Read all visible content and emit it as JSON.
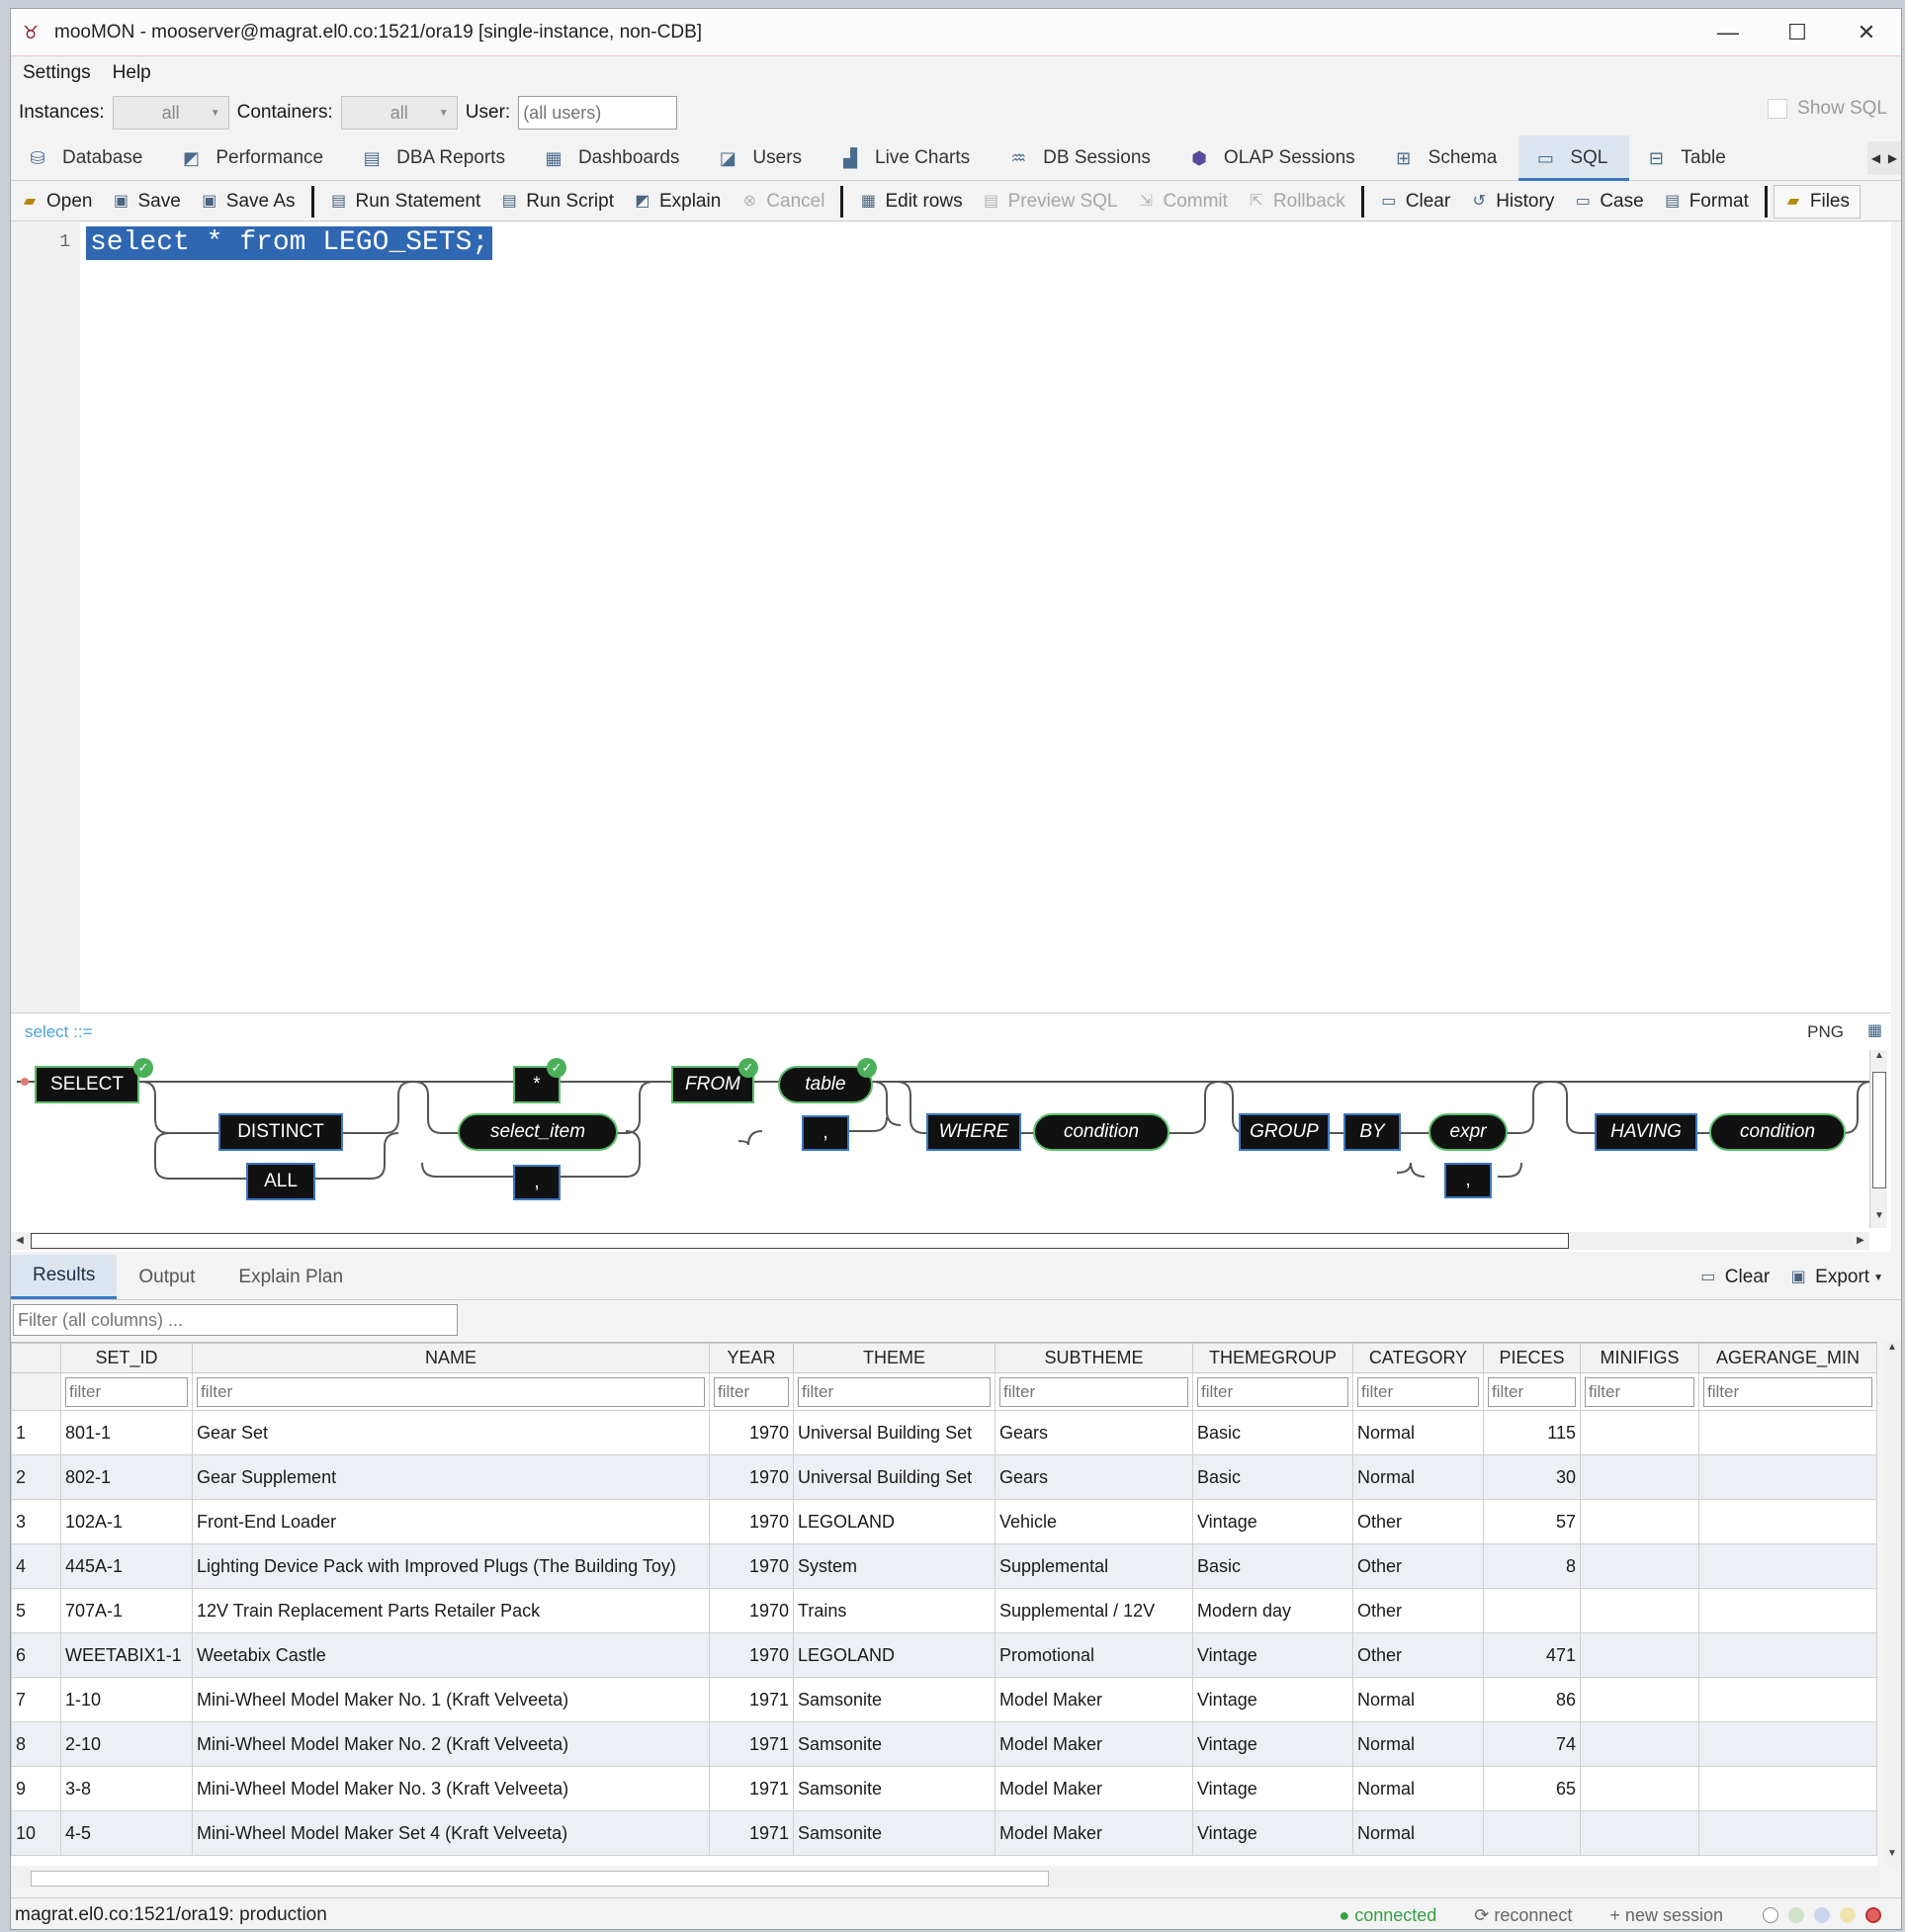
{
  "window": {
    "title": "mooMON - mooserver@magrat.el0.co:1521/ora19  [single-instance, non-CDB]"
  },
  "menu": {
    "settings": "Settings",
    "help": "Help"
  },
  "filters": {
    "instances_label": "Instances:",
    "instances_value": "all",
    "containers_label": "Containers:",
    "containers_value": "all",
    "user_label": "User:",
    "user_placeholder": "(all users)",
    "show_sql": "Show SQL"
  },
  "tabs": [
    {
      "label": "Database",
      "icon": "database-icon"
    },
    {
      "label": "Performance",
      "icon": "performance-icon"
    },
    {
      "label": "DBA Reports",
      "icon": "reports-icon"
    },
    {
      "label": "Dashboards",
      "icon": "dashboard-icon"
    },
    {
      "label": "Users",
      "icon": "users-icon"
    },
    {
      "label": "Live Charts",
      "icon": "chart-icon"
    },
    {
      "label": "DB Sessions",
      "icon": "sessions-icon"
    },
    {
      "label": "OLAP Sessions",
      "icon": "olap-icon"
    },
    {
      "label": "Schema",
      "icon": "schema-icon"
    },
    {
      "label": "SQL",
      "icon": "sql-icon"
    },
    {
      "label": "Table",
      "icon": "table-icon"
    }
  ],
  "toolbar": {
    "open": "Open",
    "save": "Save",
    "save_as": "Save As",
    "run_statement": "Run Statement",
    "run_script": "Run Script",
    "explain": "Explain",
    "cancel": "Cancel",
    "edit_rows": "Edit rows",
    "preview_sql": "Preview SQL",
    "commit": "Commit",
    "rollback": "Rollback",
    "clear": "Clear",
    "history": "History",
    "case": "Case",
    "format": "Format",
    "files": "Files"
  },
  "editor": {
    "line_number": "1",
    "code": "select * from LEGO_SETS;"
  },
  "diagram": {
    "label": "select ::=",
    "png": "PNG",
    "tokens": {
      "select": "SELECT",
      "distinct": "DISTINCT",
      "all": "ALL",
      "star": "*",
      "select_item": "select_item",
      "comma": ",",
      "from": "FROM",
      "table": "table",
      "where": "WHERE",
      "condition": "condition",
      "group": "GROUP",
      "by": "BY",
      "expr": "expr",
      "having": "HAVING"
    }
  },
  "results_tabs": {
    "results": "Results",
    "output": "Output",
    "explain_plan": "Explain Plan",
    "clear": "Clear",
    "export": "Export"
  },
  "grid": {
    "filter_all_placeholder": "Filter (all columns) ...",
    "filter_placeholder": "filter",
    "columns": [
      "SET_ID",
      "NAME",
      "YEAR",
      "THEME",
      "SUBTHEME",
      "THEMEGROUP",
      "CATEGORY",
      "PIECES",
      "MINIFIGS",
      "AGERANGE_MIN"
    ],
    "rows": [
      [
        "1",
        "801-1",
        "Gear Set",
        "1970",
        "Universal Building Set",
        "Gears",
        "Basic",
        "Normal",
        "115",
        "",
        ""
      ],
      [
        "2",
        "802-1",
        "Gear Supplement",
        "1970",
        "Universal Building Set",
        "Gears",
        "Basic",
        "Normal",
        "30",
        "",
        ""
      ],
      [
        "3",
        "102A-1",
        "Front-End Loader",
        "1970",
        "LEGOLAND",
        "Vehicle",
        "Vintage",
        "Other",
        "57",
        "",
        ""
      ],
      [
        "4",
        "445A-1",
        "Lighting Device Pack with Improved Plugs (The Building Toy)",
        "1970",
        "System",
        "Supplemental",
        "Basic",
        "Other",
        "8",
        "",
        ""
      ],
      [
        "5",
        "707A-1",
        "12V Train Replacement Parts Retailer Pack",
        "1970",
        "Trains",
        "Supplemental / 12V",
        "Modern day",
        "Other",
        "",
        "",
        ""
      ],
      [
        "6",
        "WEETABIX1-1",
        "Weetabix Castle",
        "1970",
        "LEGOLAND",
        "Promotional",
        "Vintage",
        "Other",
        "471",
        "",
        ""
      ],
      [
        "7",
        "1-10",
        "Mini-Wheel Model Maker No. 1 (Kraft Velveeta)",
        "1971",
        "Samsonite",
        "Model Maker",
        "Vintage",
        "Normal",
        "86",
        "",
        ""
      ],
      [
        "8",
        "2-10",
        "Mini-Wheel Model Maker No. 2 (Kraft Velveeta)",
        "1971",
        "Samsonite",
        "Model Maker",
        "Vintage",
        "Normal",
        "74",
        "",
        ""
      ],
      [
        "9",
        "3-8",
        "Mini-Wheel Model Maker No. 3 (Kraft Velveeta)",
        "1971",
        "Samsonite",
        "Model Maker",
        "Vintage",
        "Normal",
        "65",
        "",
        ""
      ],
      [
        "10",
        "4-5",
        "Mini-Wheel Model Maker Set 4 (Kraft Velveeta)",
        "1971",
        "Samsonite",
        "Model Maker",
        "Vintage",
        "Normal",
        "",
        "",
        ""
      ]
    ]
  },
  "status": {
    "connection": "magrat.el0.co:1521/ora19: production",
    "connected": "● connected",
    "reconnect": "⟳ reconnect",
    "new_session": "+ new session"
  },
  "colors": {
    "accent": "#3a78c3",
    "selection": "#2f67b3",
    "connected": "#35a044",
    "check": "#4cb05a"
  }
}
